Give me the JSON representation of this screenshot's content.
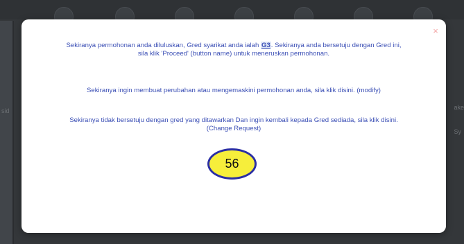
{
  "dialog": {
    "close_icon": "×",
    "paragraph1": {
      "before": "Sekiranya permohonan anda diluluskan, Gred syarikat anda ialah ",
      "grade": "G3",
      "after_line1": ". Sekiranya anda bersetuju dengan Gred ini,",
      "line2": "sila klik 'Proceed' (button name) untuk meneruskan permohonan."
    },
    "paragraph2": "Sekiranya ingin membuat perubahan atau mengemaskini permohonan anda, sila klik disini. (modify)",
    "paragraph3": {
      "line1": "Sekiranya tidak bersetuju dengan gred yang ditawarkan Dan ingin kembali kepada Gred sediada, sila klik disini.",
      "line2": "(Change Request)"
    },
    "annotation_number": "56"
  },
  "background": {
    "left_fragment": "sid",
    "right_fragment": "ake",
    "right_fragment2": "Sy"
  },
  "colors": {
    "text": "#3b4fb5",
    "badge_fill": "#f6ee3b",
    "badge_border": "#2a2ea5",
    "close": "#f3a7a7"
  }
}
